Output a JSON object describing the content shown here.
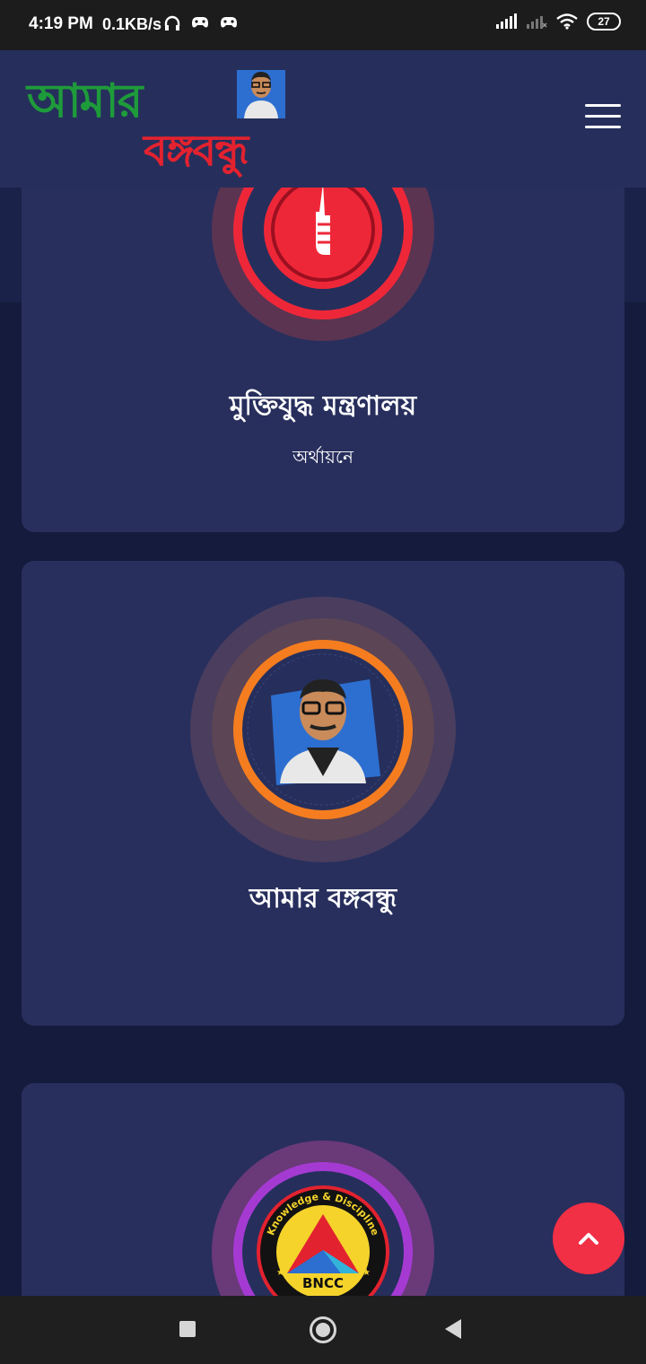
{
  "status_bar": {
    "time": "4:19 PM",
    "network_speed": "0.1KB/s",
    "battery": "27"
  },
  "header": {
    "logo_line1": "আমার",
    "logo_line2": "বঙ্গবন্ধু",
    "menu_icon": "hamburger-menu-icon"
  },
  "cards": [
    {
      "title": "মুক্তিযুদ্ধ মন্ত্রণালয়",
      "subtitle": "অর্থায়নে",
      "accent": "#ee2738"
    },
    {
      "title": "আমার বঙ্গবন্ধু",
      "subtitle": "",
      "accent": "#f57d1f"
    },
    {
      "title": "",
      "subtitle": "",
      "accent": "#a53ad3",
      "badge_top": "Knowledge & Discipline",
      "badge_label": "BNCC"
    }
  ],
  "scroll_top_icon": "chevron-up-icon",
  "nav_bar": {
    "recent_icon": "recent-apps-icon",
    "home_icon": "home-icon",
    "back_icon": "back-icon"
  }
}
